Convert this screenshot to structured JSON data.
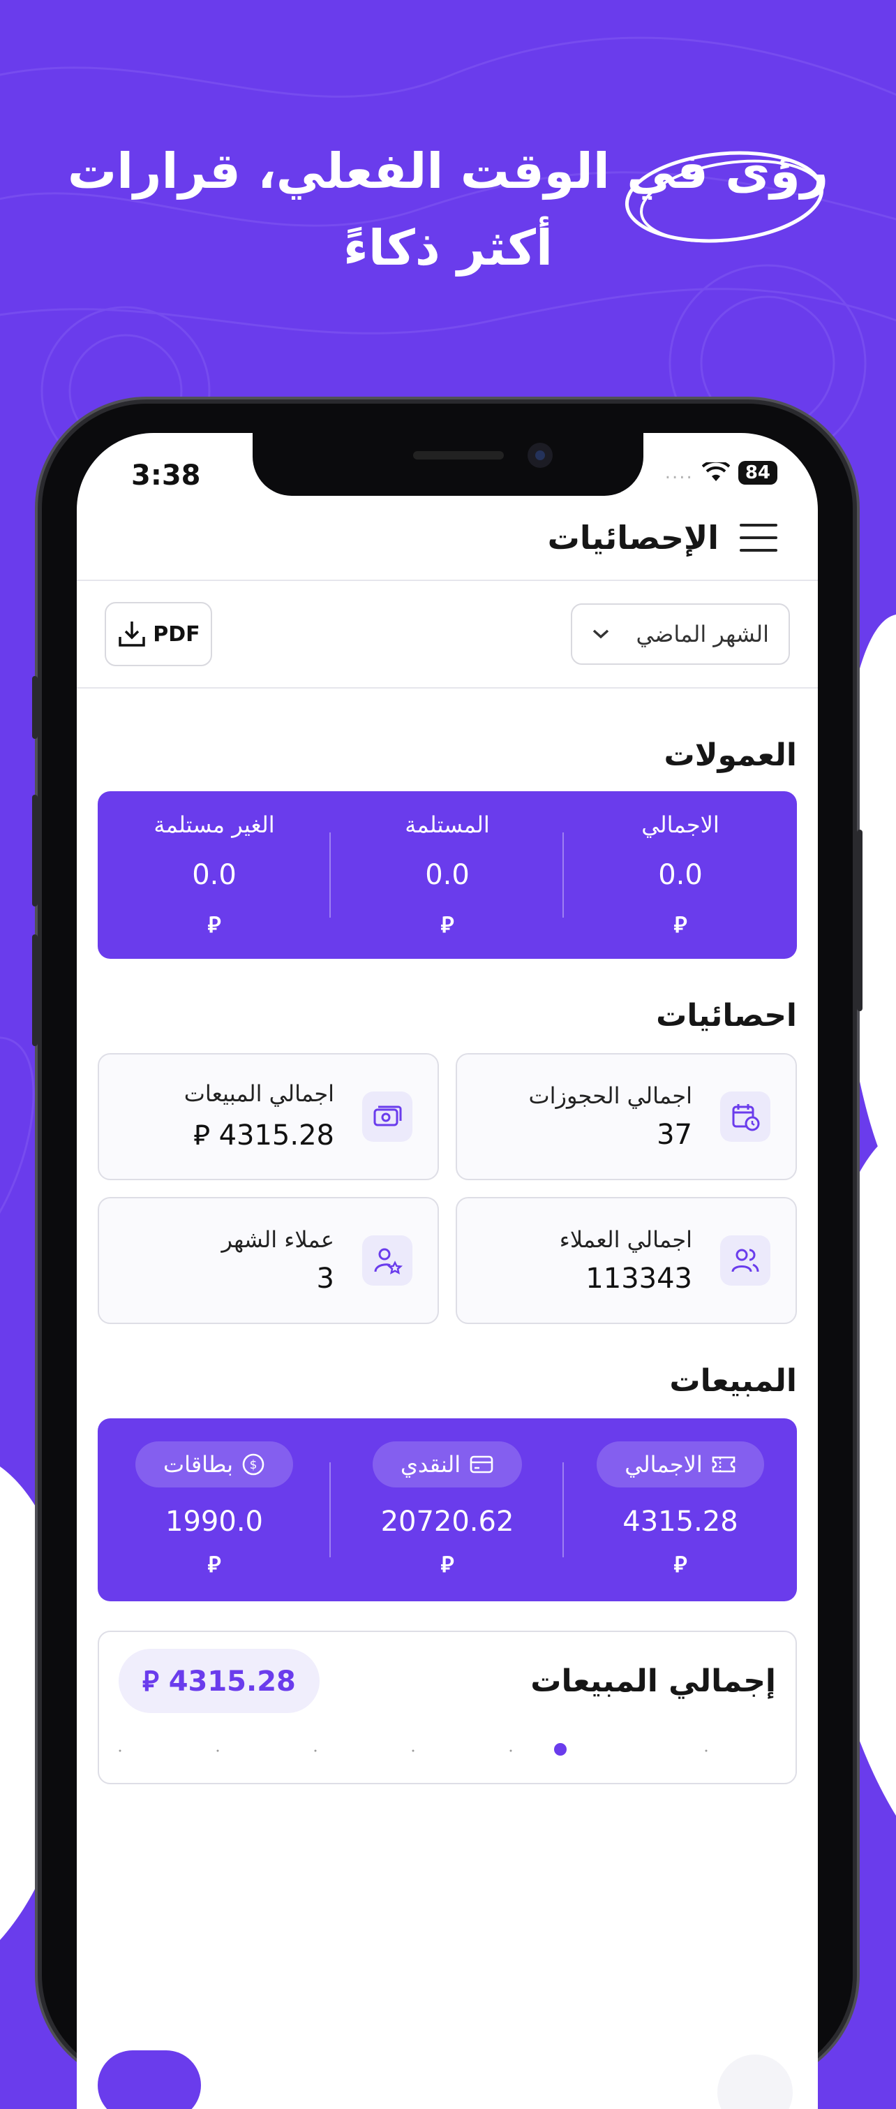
{
  "headline": {
    "line1": "رؤى في الوقت الفعلي، قرارات",
    "line2": "أكثر ذكاءً"
  },
  "status_bar": {
    "time": "3:38",
    "signal_dots": "....",
    "battery": "84"
  },
  "header": {
    "title": "الإحصائيات",
    "menu_icon": "hamburger-menu-icon"
  },
  "filters": {
    "pdf_label": "PDF",
    "period_selected": "الشهر الماضي"
  },
  "commissions": {
    "title": "العمولات",
    "columns": [
      {
        "label": "الاجمالي",
        "value": "0.0",
        "currency": "⃁"
      },
      {
        "label": "المستلمة",
        "value": "0.0",
        "currency": "⃁"
      },
      {
        "label": "الغير مستلمة",
        "value": "0.0",
        "currency": "⃁"
      }
    ]
  },
  "statistics": {
    "title": "احصائيات",
    "cards": [
      {
        "label": "اجمالي الحجوزات",
        "value": "37",
        "icon": "calendar-clock-icon"
      },
      {
        "label": "اجمالي المبيعات",
        "value": "4315.28 ⃁",
        "icon": "cash-icon"
      },
      {
        "label": "اجمالي العملاء",
        "value": "113343",
        "icon": "users-icon"
      },
      {
        "label": "عملاء الشهر",
        "value": "3",
        "icon": "user-star-icon"
      }
    ]
  },
  "sales": {
    "title": "المبيعات",
    "columns": [
      {
        "label": "الاجمالي",
        "value": "4315.28",
        "currency": "⃁",
        "icon": "ticket-icon"
      },
      {
        "label": "النقدي",
        "value": "20720.62",
        "currency": "⃁",
        "icon": "card-icon"
      },
      {
        "label": "بطاقات",
        "value": "1990.0",
        "currency": "⃁",
        "icon": "dollar-circle-icon"
      }
    ]
  },
  "sales_chart": {
    "title": "إجمالي المبيعات",
    "total": "4315.28 ⃁"
  },
  "colors": {
    "brand": "#6a3cec",
    "brand_light": "#f0eefc"
  }
}
